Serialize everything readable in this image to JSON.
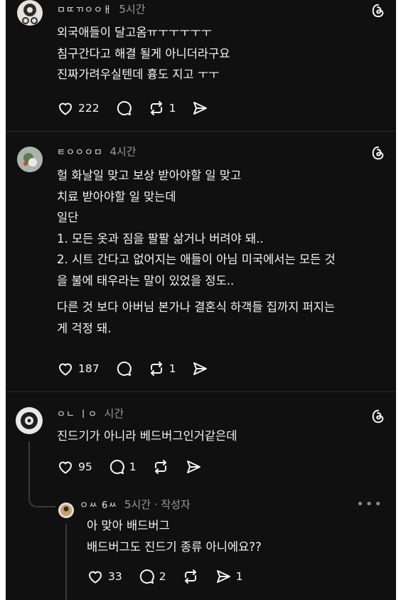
{
  "colors": {
    "background": "#101010",
    "text": "#f3f5f7",
    "meta": "#9a9a9a",
    "divider": "#2a2a2a"
  },
  "posts": [
    {
      "username": "ㅁㄸㄲㅇㅇㅐ",
      "time": "5시간",
      "lines": [
        "외국애들이 달고옴ㅠㅜㅜㅜㅜㅜ",
        "침구간다고 해결 될게 아니더라구요",
        "진짜가려우실텐데 흉도 지고 ㅜㅜ"
      ],
      "likes": "222",
      "comments": "",
      "reposts": "1",
      "shares": ""
    },
    {
      "username": "ㅌㅇㅇㅇㅁ",
      "time": "4시간",
      "lines": [
        "헐 화날일 맞고 보상 받아야할 일 맞고",
        "치료 받아야할 일 맞는데",
        "일단",
        "1. 모든 옷과 짐을 팔팔 삶거나 버려야 돼..",
        "2. 시트 간다고 없어지는 애들이 아님 미국에서는 모든 것",
        "을 불에 태우라는 말이 있었을 정도..",
        "다른 것 보다 아버님 본가나 결혼식 하객들 집까지 퍼지는",
        "게 걱정 돼."
      ],
      "likes": "187",
      "comments": "",
      "reposts": "1",
      "shares": ""
    },
    {
      "username": "ㅇㄴ ㅣㅇ",
      "time": "시간",
      "lines": [
        "진드기가 아니라 베드버그인거같은데"
      ],
      "likes": "95",
      "comments": "1",
      "reposts": "",
      "shares": ""
    },
    {
      "username": "ㅇㅆ 6ㅆ",
      "time": "5시간",
      "author_tag": "· 작성자",
      "lines": [
        "아 맞아 배드버그",
        "배드버그도 진드기 종류 아니에요??"
      ],
      "likes": "33",
      "comments": "2",
      "reposts": "",
      "shares": "1",
      "more": "•••"
    }
  ]
}
